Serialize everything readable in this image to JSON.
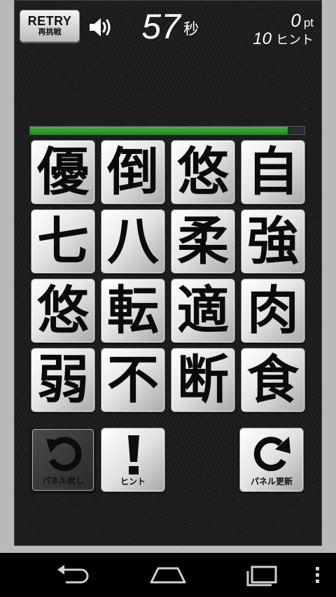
{
  "header": {
    "retry_label": "RETRY",
    "retry_sub_label": "再挑戦",
    "sound_icon": "speaker-icon",
    "timer_value": "57",
    "timer_unit": "秒",
    "score_value": "0",
    "score_unit": "pt",
    "hints_value": "10",
    "hints_unit": "ヒント"
  },
  "progress": {
    "fraction": 0.94,
    "color": "#2fa52b"
  },
  "grid": {
    "tiles": [
      "優",
      "倒",
      "悠",
      "自",
      "七",
      "八",
      "柔",
      "強",
      "悠",
      "転",
      "適",
      "肉",
      "弱",
      "不",
      "断",
      "食"
    ]
  },
  "actions": {
    "undo": {
      "label": "パネル戻し",
      "icon": "undo-arrow-icon"
    },
    "hint": {
      "label": "ヒント",
      "icon": "exclamation-icon"
    },
    "refresh": {
      "label": "パネル更新",
      "icon": "refresh-arrow-icon"
    }
  },
  "navbar": {
    "icons": [
      "back-icon",
      "home-icon",
      "recent-apps-icon",
      "menu-icon"
    ]
  }
}
